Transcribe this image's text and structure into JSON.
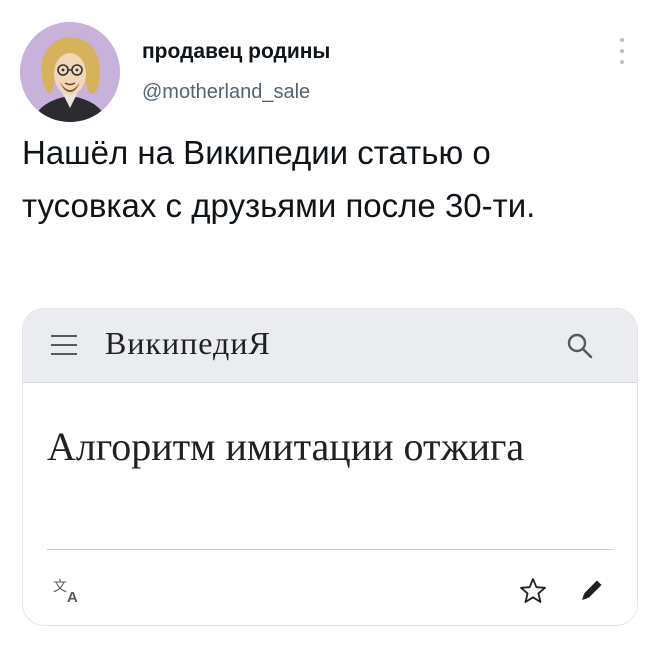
{
  "tweet": {
    "author": {
      "display_name": "продавец родины",
      "handle": "@motherland_sale"
    },
    "text": "Нашёл на Википедии статью о тусовках с друзьями после 30-ти."
  },
  "wiki_card": {
    "wordmark": "ВикипедиЯ",
    "article_title": "Алгоритм имитации отжига"
  },
  "icons": {
    "more": "more-vertical-icon",
    "menu": "hamburger-menu-icon",
    "search": "search-icon",
    "language": "translate-icon",
    "watch": "star-icon",
    "edit": "pencil-icon"
  },
  "colors": {
    "text_primary": "#0f1419",
    "text_secondary": "#536471",
    "wiki_header_bg": "#eaecf0",
    "wiki_text": "#202122"
  }
}
